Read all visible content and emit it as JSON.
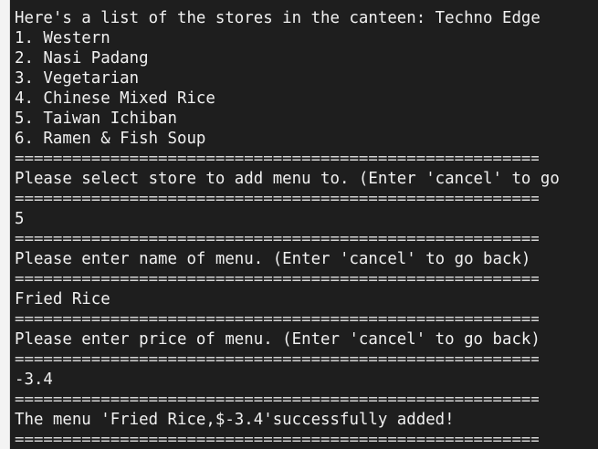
{
  "terminal": {
    "lines": [
      {
        "type": "sep",
        "text": "========================================================"
      },
      {
        "type": "text",
        "text": "Here's a list of the stores in the canteen: Techno Edge"
      },
      {
        "type": "text",
        "text": "1. Western"
      },
      {
        "type": "text",
        "text": "2. Nasi Padang"
      },
      {
        "type": "text",
        "text": "3. Vegetarian"
      },
      {
        "type": "text",
        "text": "4. Chinese Mixed Rice"
      },
      {
        "type": "text",
        "text": "5. Taiwan Ichiban"
      },
      {
        "type": "text",
        "text": "6. Ramen & Fish Soup"
      },
      {
        "type": "sep",
        "text": "========================================================"
      },
      {
        "type": "text",
        "text": "Please select store to add menu to. (Enter 'cancel' to go"
      },
      {
        "type": "sep",
        "text": "========================================================"
      },
      {
        "type": "text",
        "text": "5"
      },
      {
        "type": "sep",
        "text": "========================================================"
      },
      {
        "type": "text",
        "text": "Please enter name of menu. (Enter 'cancel' to go back)"
      },
      {
        "type": "sep",
        "text": "========================================================"
      },
      {
        "type": "text",
        "text": "Fried Rice"
      },
      {
        "type": "sep",
        "text": "========================================================"
      },
      {
        "type": "text",
        "text": "Please enter price of menu. (Enter 'cancel' to go back)"
      },
      {
        "type": "sep",
        "text": "========================================================"
      },
      {
        "type": "text",
        "text": "-3.4"
      },
      {
        "type": "sep",
        "text": "========================================================"
      },
      {
        "type": "text",
        "text": "The menu 'Fried Rice,$-3.4'successfully added!"
      },
      {
        "type": "sep",
        "text": "========================================================"
      }
    ]
  }
}
